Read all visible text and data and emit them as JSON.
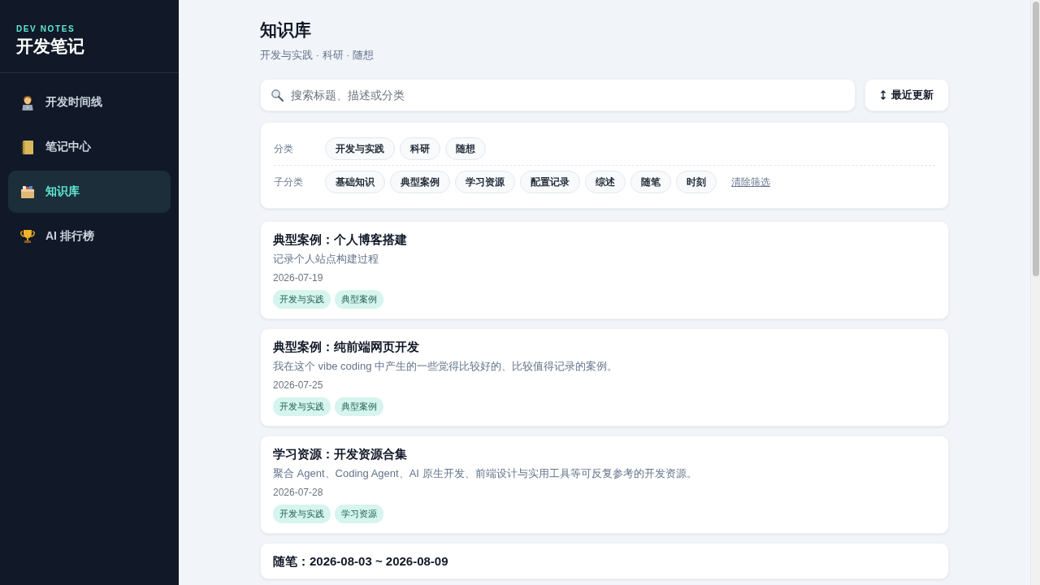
{
  "sidebar": {
    "caption": "DEV NOTES",
    "title": "开发笔记",
    "items": [
      {
        "label": "开发时间线",
        "selected": false
      },
      {
        "label": "笔记中心",
        "selected": false
      },
      {
        "label": "知识库",
        "selected": true
      },
      {
        "label": "AI 排行榜",
        "selected": false
      }
    ]
  },
  "header": {
    "title": "知识库",
    "subtitle": "开发与实践 · 科研 · 随想"
  },
  "search": {
    "placeholder": "搜索标题、描述或分类"
  },
  "sort_button": {
    "label": "最近更新"
  },
  "filters": {
    "rows": [
      {
        "label": "分类",
        "chips": [
          {
            "label": "开发与实践",
            "selected": false
          },
          {
            "label": "科研",
            "selected": false
          },
          {
            "label": "随想",
            "selected": false
          }
        ]
      },
      {
        "label": "子分类",
        "chips": [
          {
            "label": "基础知识",
            "selected": false
          },
          {
            "label": "典型案例",
            "selected": false
          },
          {
            "label": "学习资源",
            "selected": false
          },
          {
            "label": "配置记录",
            "selected": false
          },
          {
            "label": "综述",
            "selected": false
          },
          {
            "label": "随笔",
            "selected": false
          },
          {
            "label": "时刻",
            "selected": false
          }
        ]
      }
    ],
    "clear_link": "清除筛选"
  },
  "notes": [
    {
      "title": "典型案例：个人博客搭建",
      "description": "记录个人站点构建过程",
      "date": "2026-07-19",
      "tags": [
        "开发与实践",
        "典型案例"
      ]
    },
    {
      "title": "典型案例：纯前端网页开发",
      "description": "我在这个 vibe coding 中产生的一些觉得比较好的、比较值得记录的案例。",
      "date": "2026-07-25",
      "tags": [
        "开发与实践",
        "典型案例"
      ]
    },
    {
      "title": "学习资源：开发资源合集",
      "description": "聚合 Agent、Coding Agent、AI 原生开发、前端设计与实用工具等可反复参考的开发资源。",
      "date": "2026-07-28",
      "tags": [
        "开发与实践",
        "学习资源"
      ]
    },
    {
      "title": "随笔：2026-08-03 ~ 2026-08-09"
    }
  ]
}
